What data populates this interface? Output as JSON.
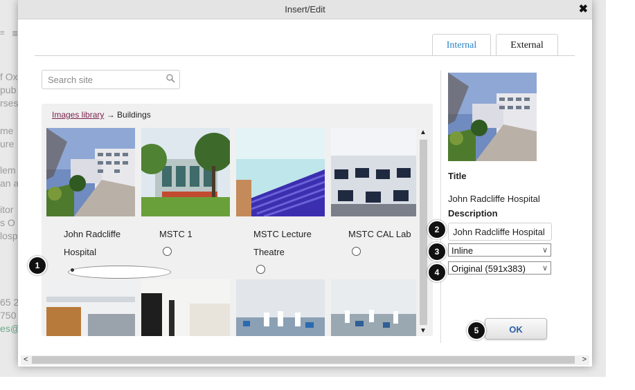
{
  "dialog": {
    "title": "Insert/Edit",
    "close_glyph": "✖",
    "tabs": [
      {
        "label": "Internal",
        "active": true
      },
      {
        "label": "External",
        "active": false
      }
    ]
  },
  "search": {
    "placeholder": "Search site",
    "icon": "search-icon"
  },
  "breadcrumb": {
    "link": "Images library",
    "arrow": "→",
    "current": "Buildings"
  },
  "images": [
    {
      "caption": "John Radcliffe Hospital",
      "selected": true
    },
    {
      "caption": "MSTC 1",
      "selected": false
    },
    {
      "caption": "MSTC Lecture Theatre",
      "selected": false
    },
    {
      "caption": "MSTC CAL Lab",
      "selected": false
    }
  ],
  "details": {
    "title_label": "Title",
    "title_value": "John Radcliffe Hospital",
    "description_label": "Description",
    "description_value": "John Radcliffe Hospital",
    "alignment": "Inline",
    "size": "Original (591x383)"
  },
  "ok_label": "OK",
  "callouts": [
    "1",
    "2",
    "3",
    "4",
    "5"
  ],
  "background_page": {
    "text_fragments": [
      "f Ox",
      "pub",
      "rses",
      "me",
      "ure",
      "lem",
      "an a",
      "itor",
      "s O",
      "losp",
      "65 2",
      "750",
      "es@"
    ]
  },
  "colors": {
    "tab_active": "#2a84c4",
    "link": "#7a1f4a",
    "ok_text": "#2a5ea8",
    "callout": "#111111"
  }
}
